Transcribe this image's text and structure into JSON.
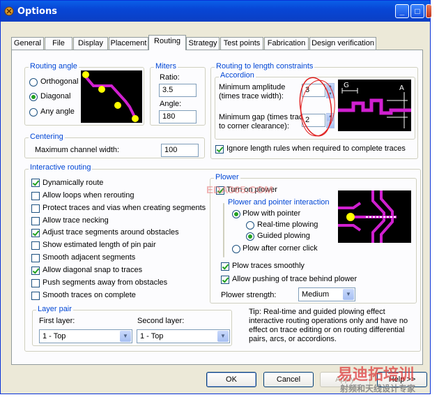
{
  "window": {
    "title": "Options"
  },
  "tabs": [
    "General",
    "File",
    "Display",
    "Placement",
    "Routing",
    "Strategy",
    "Test points",
    "Fabrication",
    "Design verification"
  ],
  "active_tab": "Routing",
  "routing_angle": {
    "label": "Routing angle",
    "options": [
      "Orthogonal",
      "Diagonal",
      "Any angle"
    ],
    "selected": "Diagonal"
  },
  "miters": {
    "label": "Miters",
    "ratio_label": "Ratio:",
    "ratio_value": "3.5",
    "angle_label": "Angle:",
    "angle_value": "180"
  },
  "length_constraints": {
    "label": "Routing to length constraints",
    "accordion_label": "Accordion",
    "min_amplitude_label_1": "Minimum amplitude",
    "min_amplitude_label_2": "(times trace width):",
    "min_amplitude_value": "3",
    "min_gap_label_1": "Minimum gap (times trace",
    "min_gap_label_2": "to corner clearance):",
    "min_gap_value": "2",
    "diagram_g": "G",
    "diagram_a": "A",
    "ignore_label": "Ignore length rules when required to complete traces",
    "ignore_checked": true
  },
  "centering": {
    "label": "Centering",
    "max_width_label": "Maximum channel width:",
    "max_width_value": "100"
  },
  "interactive": {
    "label": "Interactive routing",
    "options": [
      {
        "label": "Dynamically route",
        "checked": true
      },
      {
        "label": "Allow loops when rerouting",
        "checked": false
      },
      {
        "label": "Protect traces and vias when creating segments",
        "checked": false
      },
      {
        "label": "Allow trace necking",
        "checked": false
      },
      {
        "label": "Adjust trace segments around obstacles",
        "checked": true
      },
      {
        "label": "Show estimated length of pin pair",
        "checked": false
      },
      {
        "label": "Smooth adjacent segments",
        "checked": false
      },
      {
        "label": "Allow diagonal snap to traces",
        "checked": true
      },
      {
        "label": "Push segments away from obstacles",
        "checked": false
      },
      {
        "label": "Smooth traces on complete",
        "checked": false
      }
    ]
  },
  "layer_pair": {
    "label": "Layer pair",
    "first_label": "First layer:",
    "first_value": "1 - Top",
    "second_label": "Second layer:",
    "second_value": "1 - Top"
  },
  "plower": {
    "label": "Plower",
    "turn_on_label": "Turn on plower",
    "turn_on_checked": true,
    "interaction_label": "Plower and pointer interaction",
    "plow_pointer_label": "Plow with pointer",
    "realtime_label": "Real-time plowing",
    "guided_label": "Guided plowing",
    "after_corner_label": "Plow after corner click",
    "smoothly_label": "Plow traces smoothly",
    "smoothly_checked": true,
    "pushing_label": "Allow pushing of trace behind plower",
    "pushing_checked": true,
    "strength_label": "Plower strength:",
    "strength_value": "Medium"
  },
  "tip": {
    "text": "Tip: Real-time and guided plowing effect interactive routing operations only and have no effect on trace editing or on routing differential pairs, arcs, or accordions."
  },
  "buttons": {
    "ok": "OK",
    "cancel": "Cancel",
    "apply": "Apply",
    "help": "Help >>"
  },
  "watermarks": {
    "eda": "EDA365.COM",
    "brand1": "易迪拓培训",
    "brand2": "射频和天线设计专家"
  },
  "colors": {
    "trace": "#d020d0",
    "pad": "#ffff00",
    "accent": "#0046d5",
    "annotation": "#e02020"
  }
}
